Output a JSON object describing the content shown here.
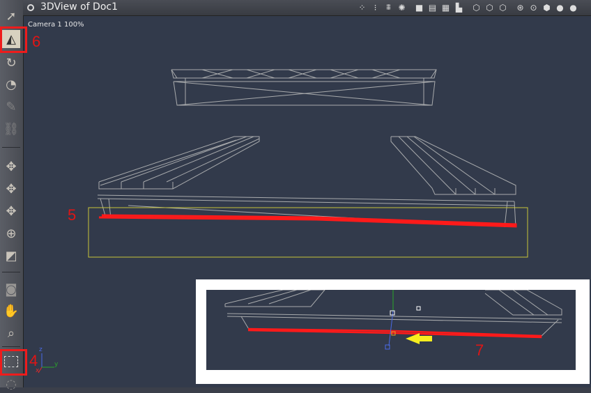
{
  "window": {
    "title": "3DView of Doc1"
  },
  "viewport": {
    "camera_label": "Camera 1 100%"
  },
  "annotations": {
    "c4": "4",
    "c5": "5",
    "c6": "6",
    "c7": "7"
  },
  "axes": {
    "x": "x",
    "y": "y",
    "z": "z"
  },
  "colors": {
    "selection_highlight": "#ff1a1a",
    "bounding_box": "#c8c43a",
    "annotation": "#e01515",
    "arrow": "#f7ee1e"
  },
  "left_tools": [
    "select-arrow-icon",
    "translate-icon",
    "rotate-icon",
    "twist-icon",
    "scale-icon",
    "chain-link-icon",
    "move-xy-icon",
    "move-xz-icon",
    "move-yz-icon",
    "move-all-icon",
    "cube-box-icon",
    "camera-icon",
    "hand-pan-icon",
    "zoom-icon",
    "marquee-select-icon",
    "orbit-icon"
  ],
  "toolbar_icons": [
    "shading-1-icon",
    "shading-2-icon",
    "shading-3-icon",
    "light-icon",
    "view-1-icon",
    "view-2-icon",
    "view-3-icon",
    "view-4-icon",
    "orient-1-icon",
    "orient-2-icon",
    "orient-3-icon",
    "nav-1-icon",
    "nav-2-icon",
    "wireframe-icon",
    "smooth-icon",
    "render-icon"
  ]
}
